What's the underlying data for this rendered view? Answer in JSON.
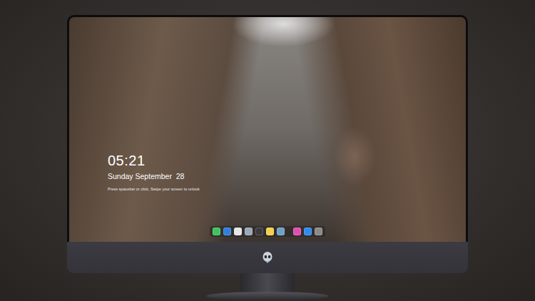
{
  "lock_screen": {
    "time": "05:21",
    "date": "Sunday September  28",
    "hint": "Press spacebar or click, Swipe your screen to unlock"
  },
  "dock": {
    "groups": [
      {
        "items": [
          {
            "color": "#3cc45a"
          },
          {
            "color": "#2f7fe0"
          },
          {
            "color": "#e6e6e6"
          },
          {
            "color": "#9aa7b8"
          },
          {
            "color": "#3a3a3e"
          },
          {
            "color": "#f5d04a"
          },
          {
            "color": "#6fa0c8"
          }
        ]
      },
      {
        "items": [
          {
            "color": "#e04fb0"
          },
          {
            "color": "#2c8cf0"
          },
          {
            "color": "#8a8a8a"
          }
        ]
      }
    ]
  }
}
